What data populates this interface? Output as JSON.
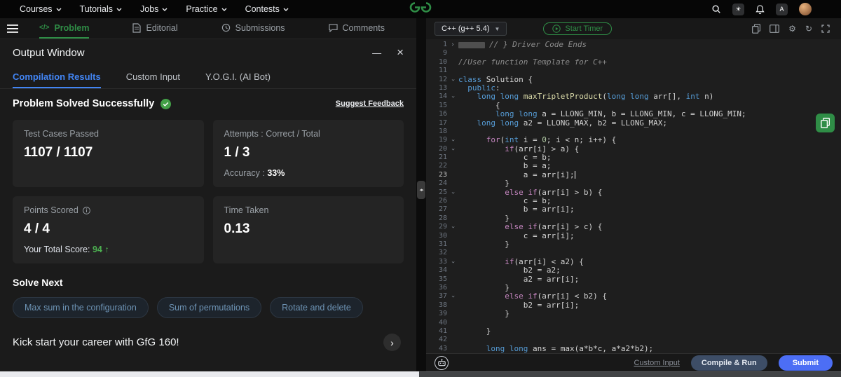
{
  "navbar": {
    "menu": [
      "Courses",
      "Tutorials",
      "Jobs",
      "Practice",
      "Contests"
    ]
  },
  "left_panel": {
    "tabs": [
      {
        "label": "Problem",
        "active": true
      },
      {
        "label": "Editorial",
        "active": false
      },
      {
        "label": "Submissions",
        "active": false
      },
      {
        "label": "Comments",
        "active": false
      }
    ],
    "output_window": {
      "title": "Output Window",
      "tabs": [
        {
          "label": "Compilation Results",
          "active": true
        },
        {
          "label": "Custom Input",
          "active": false
        },
        {
          "label": "Y.O.G.I. (AI Bot)",
          "active": false
        }
      ],
      "status": "Problem Solved Successfully",
      "feedback_link": "Suggest Feedback",
      "cards": [
        {
          "label": "Test Cases Passed",
          "value": "1107 / 1107",
          "info": false
        },
        {
          "label": "Attempts : Correct / Total",
          "value": "1 / 3",
          "info": false,
          "sub_label": "Accuracy :",
          "sub_value": "33%",
          "accent": false
        },
        {
          "label": "Points Scored",
          "value": "4 / 4",
          "info": true,
          "sub_label": "Your Total Score:",
          "sub_value": "94",
          "accent": true,
          "arrow": true
        },
        {
          "label": "Time Taken",
          "value": "0.13",
          "info": false
        }
      ],
      "solve_next_title": "Solve Next",
      "suggestions": [
        "Max sum in the configuration",
        "Sum of permutations",
        "Rotate and delete"
      ],
      "banner_text": "Kick start your career with GfG 160!"
    }
  },
  "editor": {
    "language": "C++ (g++ 5.4)",
    "start_timer_label": "Start Timer",
    "footer": {
      "custom_input": "Custom Input",
      "compile_run": "Compile & Run",
      "submit": "Submit"
    },
    "code_lines": [
      {
        "n": 1,
        "fold": ">",
        "tokens": [
          [
            "box",
            ""
          ],
          [
            "cm",
            "// } Driver Code Ends"
          ]
        ]
      },
      {
        "n": 9,
        "tokens": []
      },
      {
        "n": 10,
        "tokens": [
          [
            "cm",
            "//User function Template for C++"
          ]
        ]
      },
      {
        "n": 11,
        "tokens": []
      },
      {
        "n": 12,
        "fold": "v",
        "tokens": [
          [
            "k",
            "class"
          ],
          [
            "p",
            " Solution {"
          ]
        ]
      },
      {
        "n": 13,
        "tokens": [
          [
            "p",
            "  "
          ],
          [
            "k",
            "public"
          ],
          [
            "p",
            ":"
          ]
        ]
      },
      {
        "n": 14,
        "fold": "v",
        "tokens": [
          [
            "p",
            "    "
          ],
          [
            "k",
            "long"
          ],
          [
            "p",
            " "
          ],
          [
            "k",
            "long"
          ],
          [
            "p",
            " "
          ],
          [
            "f",
            "maxTripletProduct"
          ],
          [
            "p",
            "("
          ],
          [
            "k",
            "long"
          ],
          [
            "p",
            " "
          ],
          [
            "k",
            "long"
          ],
          [
            "p",
            " arr[], "
          ],
          [
            "k",
            "int"
          ],
          [
            "p",
            " n)"
          ]
        ]
      },
      {
        "n": 15,
        "tokens": [
          [
            "p",
            "        {"
          ]
        ]
      },
      {
        "n": 16,
        "tokens": [
          [
            "p",
            "        "
          ],
          [
            "k",
            "long"
          ],
          [
            "p",
            " "
          ],
          [
            "k",
            "long"
          ],
          [
            "p",
            " a = LLONG_MIN, b = LLONG_MIN, c = LLONG_MIN;"
          ]
        ]
      },
      {
        "n": 17,
        "tokens": [
          [
            "p",
            "    "
          ],
          [
            "k",
            "long"
          ],
          [
            "p",
            " "
          ],
          [
            "k",
            "long"
          ],
          [
            "p",
            " a2 = LLONG_MAX, b2 = LLONG_MAX;"
          ]
        ]
      },
      {
        "n": 18,
        "tokens": []
      },
      {
        "n": 19,
        "fold": "v",
        "tokens": [
          [
            "p",
            "      "
          ],
          [
            "c",
            "for"
          ],
          [
            "p",
            "("
          ],
          [
            "k",
            "int"
          ],
          [
            "p",
            " i = "
          ],
          [
            "num",
            "0"
          ],
          [
            "p",
            "; i < n; i++) {"
          ]
        ]
      },
      {
        "n": 20,
        "fold": "v",
        "tokens": [
          [
            "p",
            "          "
          ],
          [
            "c",
            "if"
          ],
          [
            "p",
            "(arr[i] > a) {"
          ]
        ]
      },
      {
        "n": 21,
        "tokens": [
          [
            "p",
            "              c = b;"
          ]
        ]
      },
      {
        "n": 22,
        "tokens": [
          [
            "p",
            "              b = a;"
          ]
        ]
      },
      {
        "n": 23,
        "cursor": true,
        "tokens": [
          [
            "p",
            "              a = arr[i];"
          ]
        ]
      },
      {
        "n": 24,
        "tokens": [
          [
            "p",
            "          }"
          ]
        ]
      },
      {
        "n": 25,
        "fold": "v",
        "tokens": [
          [
            "p",
            "          "
          ],
          [
            "c",
            "else"
          ],
          [
            "p",
            " "
          ],
          [
            "c",
            "if"
          ],
          [
            "p",
            "(arr[i] > b) {"
          ]
        ]
      },
      {
        "n": 26,
        "tokens": [
          [
            "p",
            "              c = b;"
          ]
        ]
      },
      {
        "n": 27,
        "tokens": [
          [
            "p",
            "              b = arr[i];"
          ]
        ]
      },
      {
        "n": 28,
        "tokens": [
          [
            "p",
            "          }"
          ]
        ]
      },
      {
        "n": 29,
        "fold": "v",
        "tokens": [
          [
            "p",
            "          "
          ],
          [
            "c",
            "else"
          ],
          [
            "p",
            " "
          ],
          [
            "c",
            "if"
          ],
          [
            "p",
            "(arr[i] > c) {"
          ]
        ]
      },
      {
        "n": 30,
        "tokens": [
          [
            "p",
            "              c = arr[i];"
          ]
        ]
      },
      {
        "n": 31,
        "tokens": [
          [
            "p",
            "          }"
          ]
        ]
      },
      {
        "n": 32,
        "tokens": []
      },
      {
        "n": 33,
        "fold": "v",
        "tokens": [
          [
            "p",
            "          "
          ],
          [
            "c",
            "if"
          ],
          [
            "p",
            "(arr[i] < a2) {"
          ]
        ]
      },
      {
        "n": 34,
        "tokens": [
          [
            "p",
            "              b2 = a2;"
          ]
        ]
      },
      {
        "n": 35,
        "tokens": [
          [
            "p",
            "              a2 = arr[i];"
          ]
        ]
      },
      {
        "n": 36,
        "tokens": [
          [
            "p",
            "          }"
          ]
        ]
      },
      {
        "n": 37,
        "fold": "v",
        "tokens": [
          [
            "p",
            "          "
          ],
          [
            "c",
            "else"
          ],
          [
            "p",
            " "
          ],
          [
            "c",
            "if"
          ],
          [
            "p",
            "(arr[i] < b2) {"
          ]
        ]
      },
      {
        "n": 38,
        "tokens": [
          [
            "p",
            "              b2 = arr[i];"
          ]
        ]
      },
      {
        "n": 39,
        "tokens": [
          [
            "p",
            "          }"
          ]
        ]
      },
      {
        "n": 40,
        "tokens": []
      },
      {
        "n": 41,
        "tokens": [
          [
            "p",
            "      }"
          ]
        ]
      },
      {
        "n": 42,
        "tokens": []
      },
      {
        "n": 43,
        "tokens": [
          [
            "p",
            "      "
          ],
          [
            "k",
            "long"
          ],
          [
            "p",
            " "
          ],
          [
            "k",
            "long"
          ],
          [
            "p",
            " ans = max(a*b*c, a*a2*b2);"
          ]
        ]
      }
    ]
  },
  "colors": {
    "brand_green": "#2f8d46",
    "active_tab_blue": "#4285f4",
    "submit_blue": "#4c6ef5",
    "success_green": "#4caf50"
  }
}
